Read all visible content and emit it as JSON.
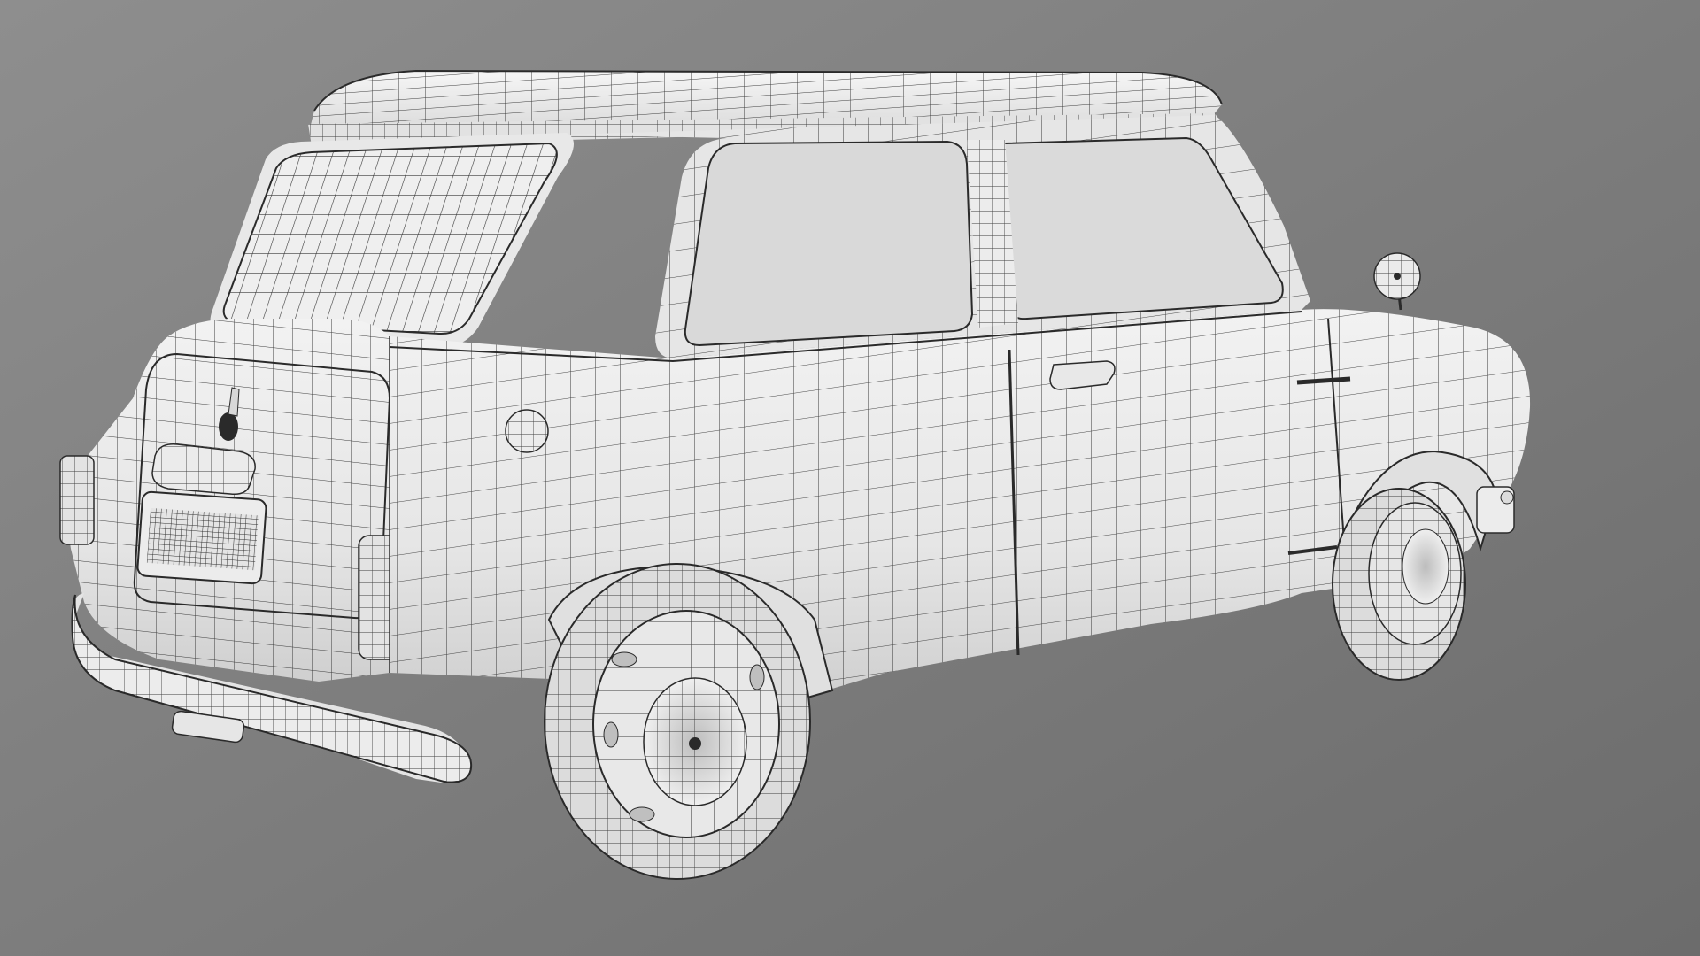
{
  "scene": {
    "kind": "3d-viewport-render",
    "render_style": "wireframe-on-shaded",
    "subject": "classic-mini-car",
    "view": "rear-three-quarter",
    "colors": {
      "background_top": "#8d8d8d",
      "background_bottom": "#707070",
      "body": "#ececec",
      "body_shadow": "#c8c8c8",
      "glass": "#d8d8d8",
      "wire": "#1e1e1e",
      "tire": "#dadada"
    }
  }
}
